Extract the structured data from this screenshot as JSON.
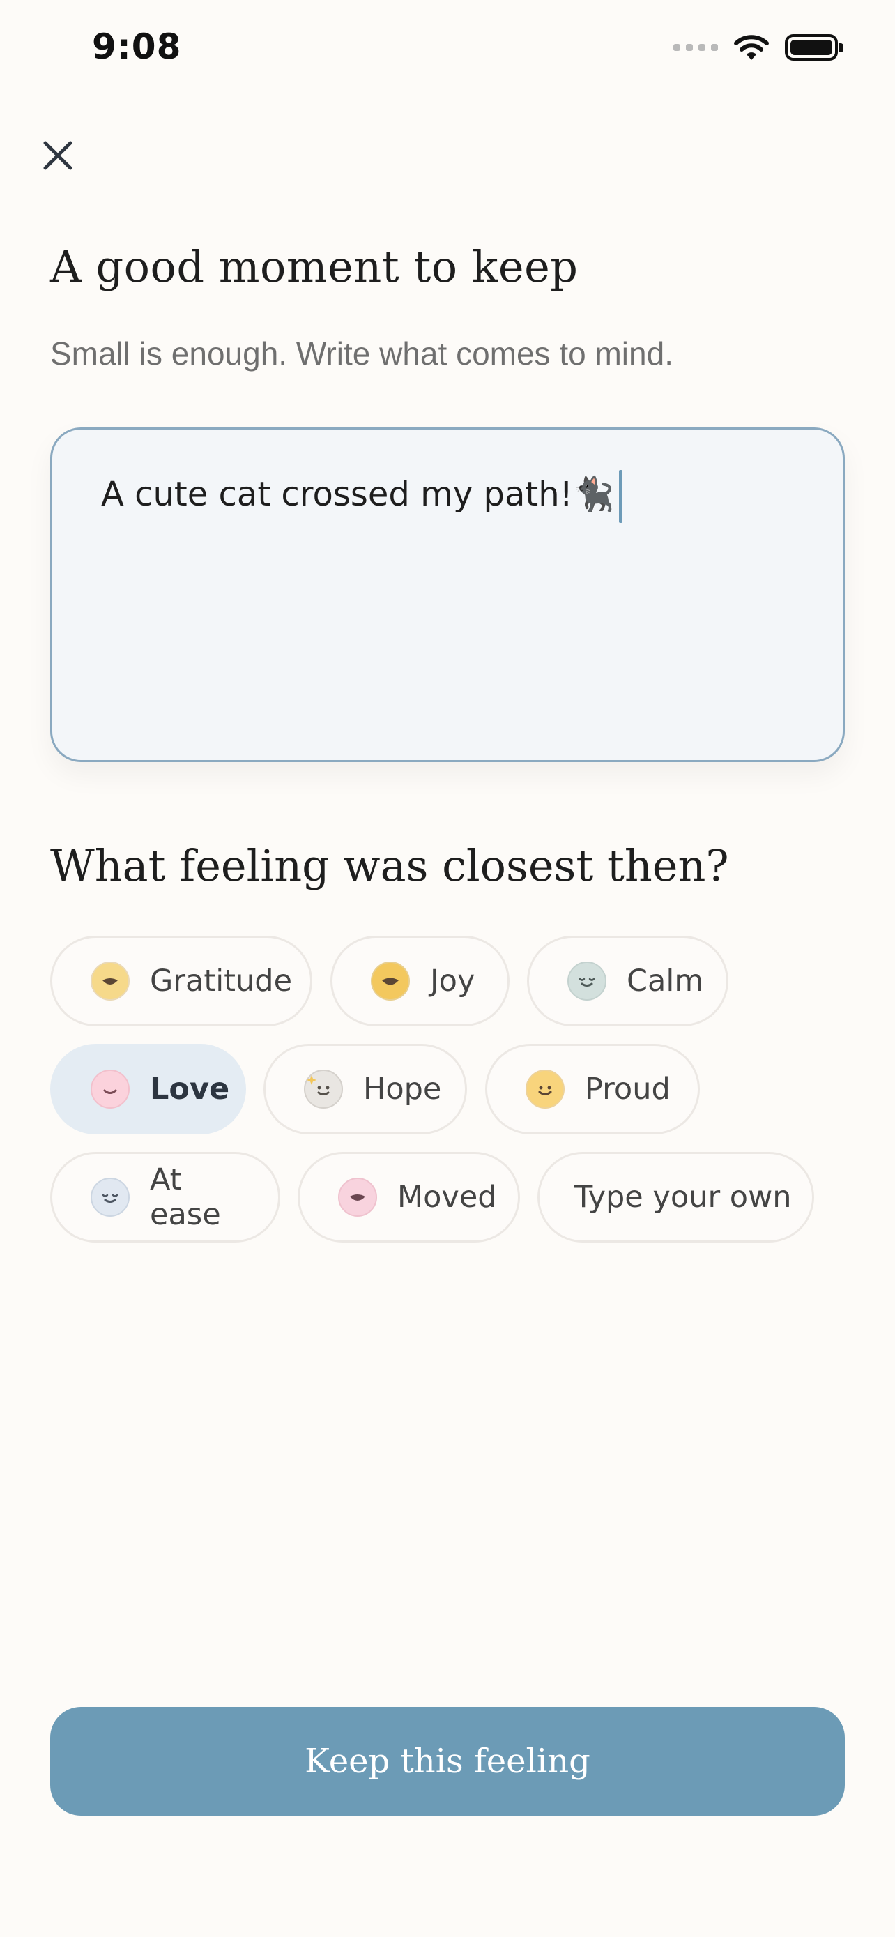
{
  "status_bar": {
    "time": "9:08"
  },
  "colors": {
    "background": "#fdfbf8",
    "accent": "#6c9bb6",
    "selected_chip": "#e4ecf3",
    "entry_border": "#8aa9c0"
  },
  "header": {
    "close_icon": "close-icon",
    "title": "A good moment to keep",
    "subtitle": "Small is enough. Write what comes to mind."
  },
  "entry": {
    "value": "A cute cat crossed my path!🐈‍⬛"
  },
  "feelings": {
    "title": "What feeling was closest then?",
    "chips": [
      {
        "label": "Gratitude",
        "icon": "gratitude-face-icon",
        "color": "#f6d98a",
        "selected": false
      },
      {
        "label": "Joy",
        "icon": "joy-face-icon",
        "color": "#f3c85e",
        "selected": false
      },
      {
        "label": "Calm",
        "icon": "calm-face-icon",
        "color": "#d3e0dd",
        "selected": false
      },
      {
        "label": "Love",
        "icon": "love-face-icon",
        "color": "#fbd2dc",
        "selected": true
      },
      {
        "label": "Hope",
        "icon": "hope-face-icon",
        "color": "#e9e6e2",
        "selected": false
      },
      {
        "label": "Proud",
        "icon": "proud-face-icon",
        "color": "#f8d47c",
        "selected": false
      },
      {
        "label": "At ease",
        "icon": "at-ease-face-icon",
        "color": "#e1e8f1",
        "selected": false
      },
      {
        "label": "Moved",
        "icon": "moved-face-icon",
        "color": "#f8d3de",
        "selected": false
      },
      {
        "label": "Type your own",
        "icon": "",
        "color": "",
        "selected": false
      }
    ]
  },
  "primary_button": {
    "label": "Keep this feeling"
  }
}
